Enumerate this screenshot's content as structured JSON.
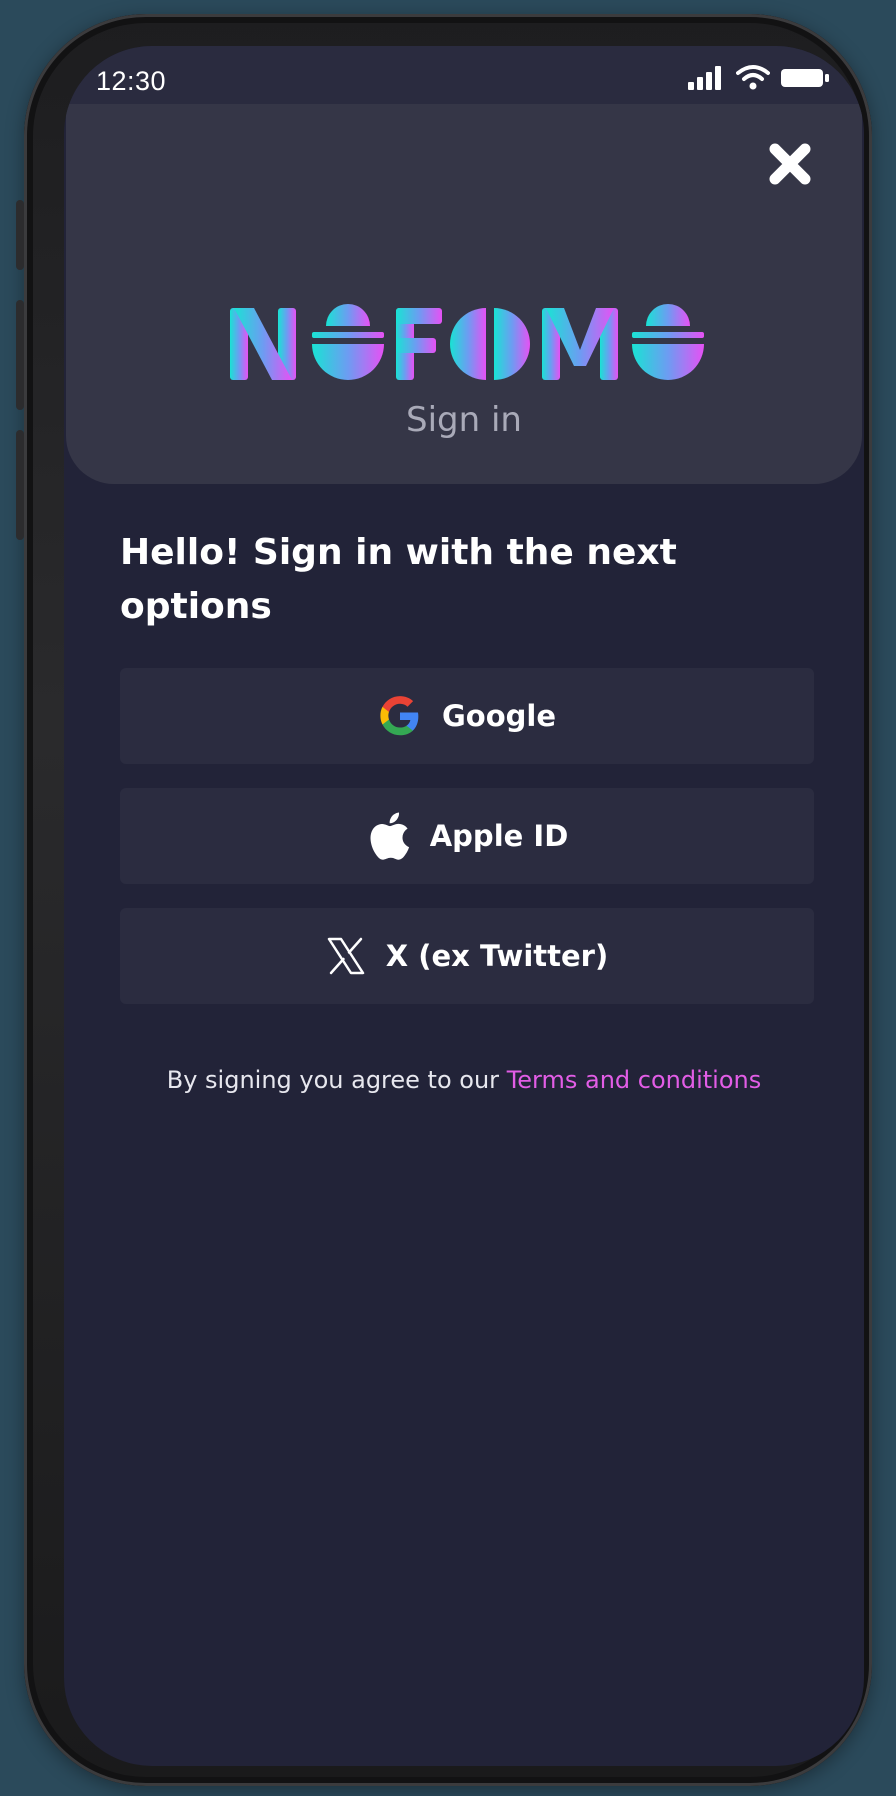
{
  "status_bar": {
    "time": "12:30",
    "icons": [
      "signal-icon",
      "wifi-icon",
      "battery-icon"
    ]
  },
  "header": {
    "close_icon": "close-icon",
    "logo_text": "NOFOMO",
    "subtitle": "Sign in"
  },
  "greeting": "Hello! Sign in with the next options",
  "options": [
    {
      "label": "Google",
      "icon": "google-icon"
    },
    {
      "label": "Apple ID",
      "icon": "apple-icon"
    },
    {
      "label": "X (ex Twitter)",
      "icon": "x-twitter-icon"
    }
  ],
  "terms": {
    "prefix": "By signing you agree to our",
    "link": "Terms and conditions"
  },
  "colors": {
    "background": "#222338",
    "header_card": "#353647",
    "option_button": "#2b2c40",
    "link": "#e25de6",
    "logo_gradient_start": "#19e3d4",
    "logo_gradient_end": "#e651f4"
  }
}
